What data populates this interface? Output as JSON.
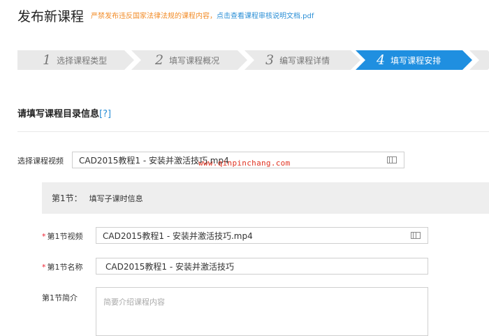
{
  "header": {
    "title": "发布新课程",
    "notice_prefix": "严禁发布违反国家法律法规的课程内容，",
    "notice_link": "点击查看课程审核说明文档.pdf"
  },
  "steps": [
    {
      "num": "1",
      "label": "选择课程类型",
      "active": false
    },
    {
      "num": "2",
      "label": "填写课程概况",
      "active": false
    },
    {
      "num": "3",
      "label": "编写课程详情",
      "active": false
    },
    {
      "num": "4",
      "label": "填写课程安排",
      "active": true
    }
  ],
  "section": {
    "title": "请填写课程目录信息",
    "help": "[?]"
  },
  "select_video": {
    "label": "选择课程视频",
    "value": "CAD2015教程1 - 安装并激活技巧.mp4"
  },
  "watermark": "www.qinpinchang.com",
  "lesson": {
    "header_lead": "第1节：",
    "header_text": "填写子课时信息",
    "video_label": "第1节视频",
    "video_value": "CAD2015教程1 - 安装并激活技巧.mp4",
    "name_label": "第1节名称",
    "name_value": "CAD2015教程1 - 安装并激活技巧",
    "intro_label": "第1节简介",
    "intro_placeholder": "简要介绍课程内容"
  },
  "colors": {
    "accent": "#1f8fe0",
    "notice": "#f28c28",
    "link": "#2b8fd6",
    "required": "#e23333"
  }
}
